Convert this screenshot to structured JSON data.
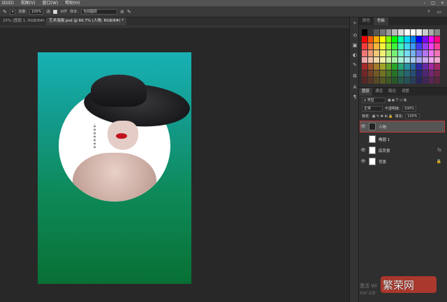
{
  "menubar": {
    "items": [
      "3D(D)",
      "视图(V)",
      "窗口(W)",
      "帮助(H)"
    ],
    "window_controls": [
      "–",
      "□",
      "×"
    ]
  },
  "optionsbar": {
    "opacity_label": "流量:",
    "opacity_value": "100%",
    "align_label": "对齐",
    "sample_label": "样本:",
    "sample_value": "当前图层"
  },
  "tabs": [
    {
      "label": "25% (图层 1, RGB/8#) *",
      "active": false
    },
    {
      "label": "艺术海报.psd @ 66.7% (人物, RGB/8#) *",
      "active": true
    }
  ],
  "panel_top": {
    "tabs": [
      {
        "label": "颜色",
        "active": false
      },
      {
        "label": "色板",
        "active": true
      }
    ]
  },
  "panel_layers": {
    "tabs": [
      {
        "label": "图层",
        "active": true
      },
      {
        "label": "通道",
        "active": false
      },
      {
        "label": "路径",
        "active": false
      },
      {
        "label": "调整",
        "active": false
      }
    ],
    "filter_label": "ρ 类型",
    "blend_mode": "正常",
    "opacity_label": "不透明度:",
    "opacity_value": "100%",
    "lock_label": "锁定:",
    "fill_label": "填充:",
    "fill_value": "100%",
    "layers": [
      {
        "name": "人物",
        "selected": true
      },
      {
        "name": "椭圆 1",
        "selected": false
      },
      {
        "name": "底背景",
        "selected": false
      },
      {
        "name": "背景",
        "selected": false
      }
    ]
  },
  "watermark": {
    "text": "繁荣网"
  },
  "activate": {
    "line1": "激活 Wi",
    "line2": "转到\"设置\""
  },
  "colors": {
    "canvas_top": "#18b1b5",
    "canvas_bottom": "#087034",
    "selection_outline": "#c43c3c"
  }
}
